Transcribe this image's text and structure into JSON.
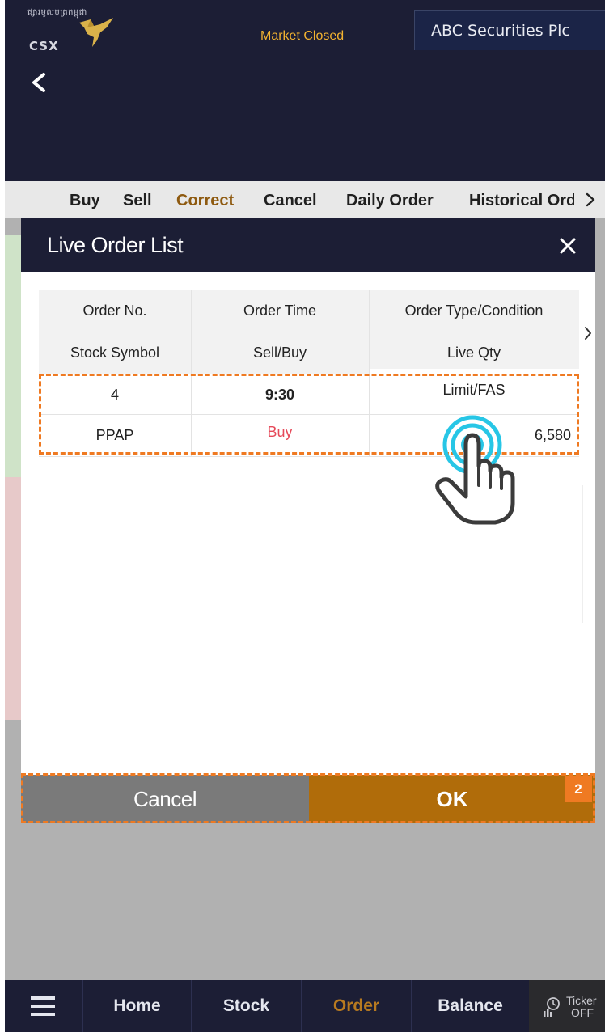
{
  "header": {
    "logo_khmer": "ផ្សារមូលបត្រកម្ពុជា",
    "logo_text": "CSX",
    "market_status": "Market Closed",
    "broker_name": "ABC Securities Plc"
  },
  "tabs": [
    {
      "label": "Buy"
    },
    {
      "label": "Sell"
    },
    {
      "label": "Correct"
    },
    {
      "label": "Cancel"
    },
    {
      "label": "Daily Order"
    },
    {
      "label": "Historical Order"
    }
  ],
  "modal": {
    "title": "Live Order List",
    "columns_row1": [
      "Order No.",
      "Order Time",
      "Order Type/Condition"
    ],
    "columns_row2": [
      "Stock Symbol",
      "Sell/Buy",
      "Live Qty"
    ],
    "rows": [
      {
        "order_no": "4",
        "order_time": "9:30",
        "order_type": "Limit/FAS",
        "stock_symbol": "PPAP",
        "side": "Buy",
        "live_qty": "6,580"
      }
    ],
    "cancel_label": "Cancel",
    "ok_label": "OK",
    "step_badge": "2"
  },
  "bottom_nav": {
    "items": [
      {
        "label": "Home"
      },
      {
        "label": "Stock"
      },
      {
        "label": "Order"
      },
      {
        "label": "Balance"
      }
    ],
    "ticker_label": "Ticker",
    "ticker_state": "OFF"
  },
  "colors": {
    "navy": "#1c1e35",
    "accent_gold": "#b06c0a",
    "buy_red": "#e64a5a",
    "highlight_orange": "#ef7a22",
    "market_status": "#f2b230"
  }
}
